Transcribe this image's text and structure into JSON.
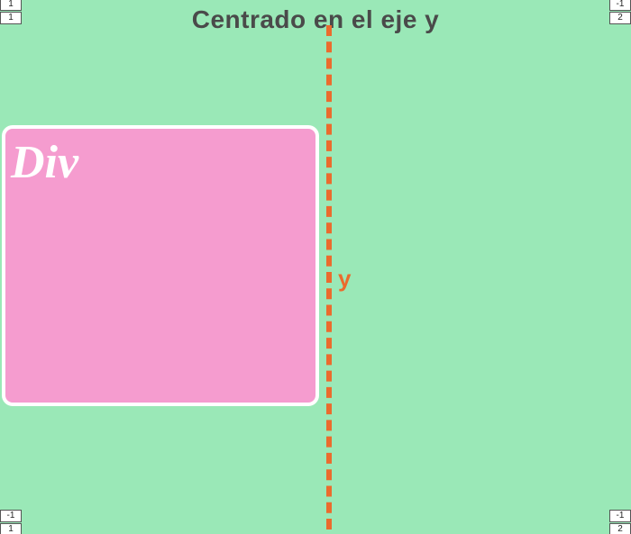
{
  "title": "Centrado en el eje y",
  "axis": {
    "label": "y"
  },
  "box": {
    "label": "Div"
  },
  "corners": {
    "top_left": {
      "a": "1",
      "b": "1"
    },
    "top_right": {
      "a": "-1",
      "b": "2"
    },
    "bottom_left": {
      "a": "-1",
      "b": "1"
    },
    "bottom_right": {
      "a": "-1",
      "b": "2"
    }
  }
}
